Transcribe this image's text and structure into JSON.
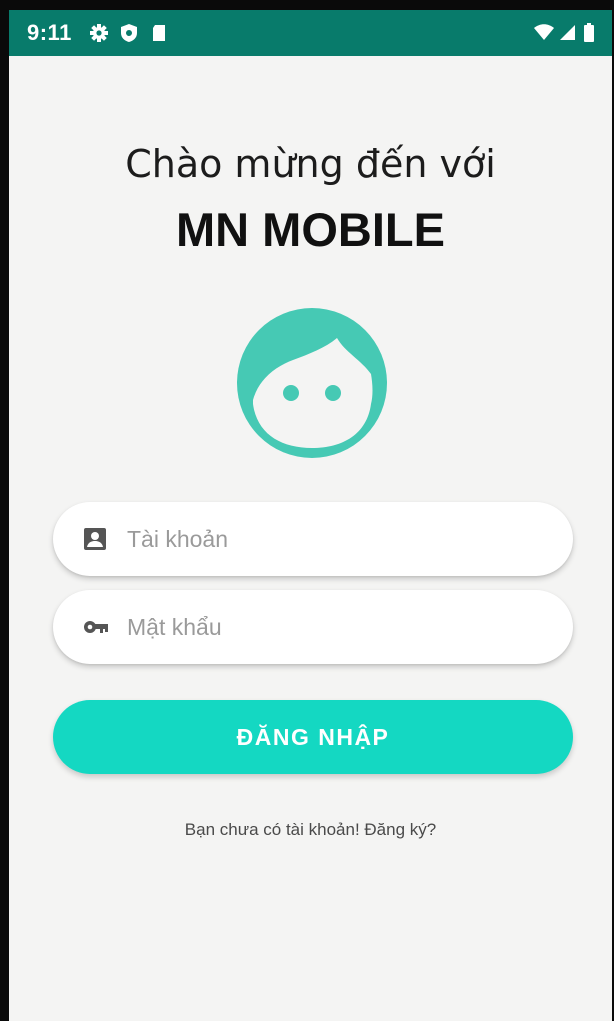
{
  "status_bar": {
    "time": "9:11",
    "left_icons": [
      "gear-icon",
      "shield-icon",
      "sd-card-icon"
    ],
    "right_icons": [
      "wifi-icon",
      "signal-icon",
      "battery-icon"
    ],
    "background": "#087b6b"
  },
  "header": {
    "welcome": "Chào mừng đến với",
    "app_name": "MN MOBILE"
  },
  "avatar": {
    "icon": "face-icon",
    "color": "#46c9b4"
  },
  "form": {
    "username_placeholder": "Tài khoản",
    "username_value": "",
    "password_placeholder": "Mật khẩu",
    "password_value": "",
    "login_label": "ĐĂNG NHẬP",
    "register_text": "Bạn chưa có tài khoản! Đăng ký?"
  },
  "colors": {
    "accent": "#14d8c2",
    "background": "#f4f4f3"
  }
}
